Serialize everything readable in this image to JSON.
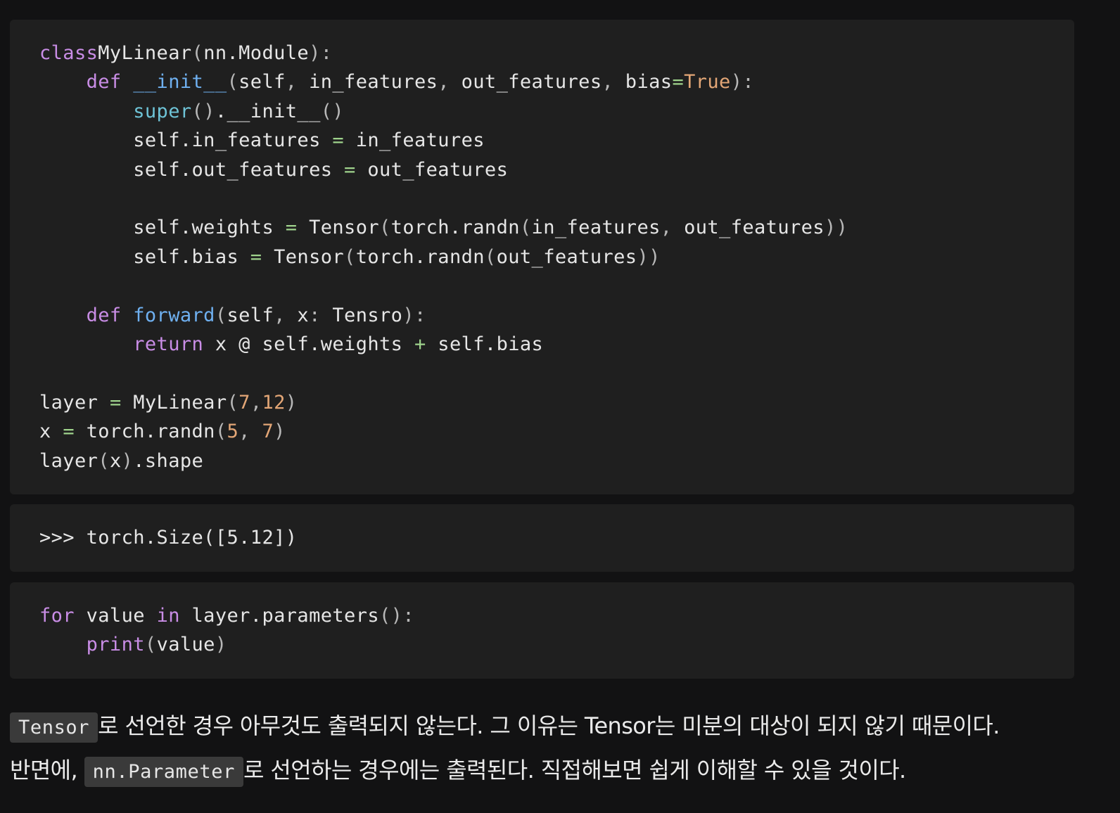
{
  "code_block_1": {
    "lines": [
      [
        [
          "kw",
          "class"
        ],
        [
          "",
          "MyLinear"
        ],
        [
          "pn",
          "("
        ],
        [
          "",
          "nn.Module"
        ],
        [
          "pn",
          "):"
        ]
      ],
      [
        [
          "",
          "    "
        ],
        [
          "kw",
          "def"
        ],
        [
          "",
          " "
        ],
        [
          "fn",
          "__init__"
        ],
        [
          "pn",
          "("
        ],
        [
          "",
          "self"
        ],
        [
          "pn",
          ","
        ],
        [
          "",
          " in_features"
        ],
        [
          "pn",
          ","
        ],
        [
          "",
          " out_features"
        ],
        [
          "pn",
          ","
        ],
        [
          "",
          " bias"
        ],
        [
          "op",
          "="
        ],
        [
          "num",
          "True"
        ],
        [
          "pn",
          "):"
        ]
      ],
      [
        [
          "",
          "        "
        ],
        [
          "bi",
          "super"
        ],
        [
          "pn",
          "()"
        ],
        [
          "",
          "."
        ],
        [
          "",
          "__init__"
        ],
        [
          "pn",
          "()"
        ]
      ],
      [
        [
          "",
          "        self.in_features "
        ],
        [
          "op",
          "="
        ],
        [
          "",
          " in_features"
        ]
      ],
      [
        [
          "",
          "        self.out_features "
        ],
        [
          "op",
          "="
        ],
        [
          "",
          " out_features"
        ]
      ],
      [
        [
          "",
          ""
        ]
      ],
      [
        [
          "",
          "        self.weights "
        ],
        [
          "op",
          "="
        ],
        [
          "",
          " Tensor"
        ],
        [
          "pn",
          "("
        ],
        [
          "",
          "torch.randn"
        ],
        [
          "pn",
          "("
        ],
        [
          "",
          "in_features"
        ],
        [
          "pn",
          ","
        ],
        [
          "",
          " out_features"
        ],
        [
          "pn",
          "))"
        ]
      ],
      [
        [
          "",
          "        self.bias "
        ],
        [
          "op",
          "="
        ],
        [
          "",
          " Tensor"
        ],
        [
          "pn",
          "("
        ],
        [
          "",
          "torch.randn"
        ],
        [
          "pn",
          "("
        ],
        [
          "",
          "out_features"
        ],
        [
          "pn",
          "))"
        ]
      ],
      [
        [
          "",
          ""
        ]
      ],
      [
        [
          "",
          "    "
        ],
        [
          "kw",
          "def"
        ],
        [
          "",
          " "
        ],
        [
          "fn",
          "forward"
        ],
        [
          "pn",
          "("
        ],
        [
          "",
          "self"
        ],
        [
          "pn",
          ","
        ],
        [
          "",
          " x"
        ],
        [
          "pn",
          ":"
        ],
        [
          "",
          " Tensro"
        ],
        [
          "pn",
          "):"
        ]
      ],
      [
        [
          "",
          "        "
        ],
        [
          "kw",
          "return"
        ],
        [
          "",
          " x @ self.weights "
        ],
        [
          "op",
          "+"
        ],
        [
          "",
          " self.bias"
        ]
      ],
      [
        [
          "",
          ""
        ]
      ],
      [
        [
          "",
          "layer "
        ],
        [
          "op",
          "="
        ],
        [
          "",
          " MyLinear"
        ],
        [
          "pn",
          "("
        ],
        [
          "num",
          "7"
        ],
        [
          "pn",
          ","
        ],
        [
          "num",
          "12"
        ],
        [
          "pn",
          ")"
        ]
      ],
      [
        [
          "",
          "x "
        ],
        [
          "op",
          "="
        ],
        [
          "",
          " torch.randn"
        ],
        [
          "pn",
          "("
        ],
        [
          "num",
          "5"
        ],
        [
          "pn",
          ","
        ],
        [
          "",
          " "
        ],
        [
          "num",
          "7"
        ],
        [
          "pn",
          ")"
        ]
      ],
      [
        [
          "",
          "layer"
        ],
        [
          "pn",
          "("
        ],
        [
          "",
          "x"
        ],
        [
          "pn",
          ")"
        ],
        [
          "",
          ".shape"
        ]
      ]
    ]
  },
  "output_block": {
    "text": ">>> torch.Size([5.12])"
  },
  "code_block_2": {
    "lines": [
      [
        [
          "kw",
          "for"
        ],
        [
          "",
          " value "
        ],
        [
          "kw",
          "in"
        ],
        [
          "",
          " layer.parameters"
        ],
        [
          "pn",
          "():"
        ]
      ],
      [
        [
          "",
          "    "
        ],
        [
          "kw",
          "print"
        ],
        [
          "pn",
          "("
        ],
        [
          "",
          "value"
        ],
        [
          "pn",
          ")"
        ]
      ]
    ]
  },
  "prose": {
    "line1_code": "Tensor",
    "line1_text": "로 선언한 경우 아무것도 출력되지 않는다. 그 이유는 Tensor는 미분의 대상이 되지 않기 때문이다.",
    "line2_prefix": "반면에, ",
    "line2_code": "nn.Parameter",
    "line2_text": "로 선언하는 경우에는 출력된다. 직접해보면 쉽게 이해할 수 있을 것이다."
  }
}
